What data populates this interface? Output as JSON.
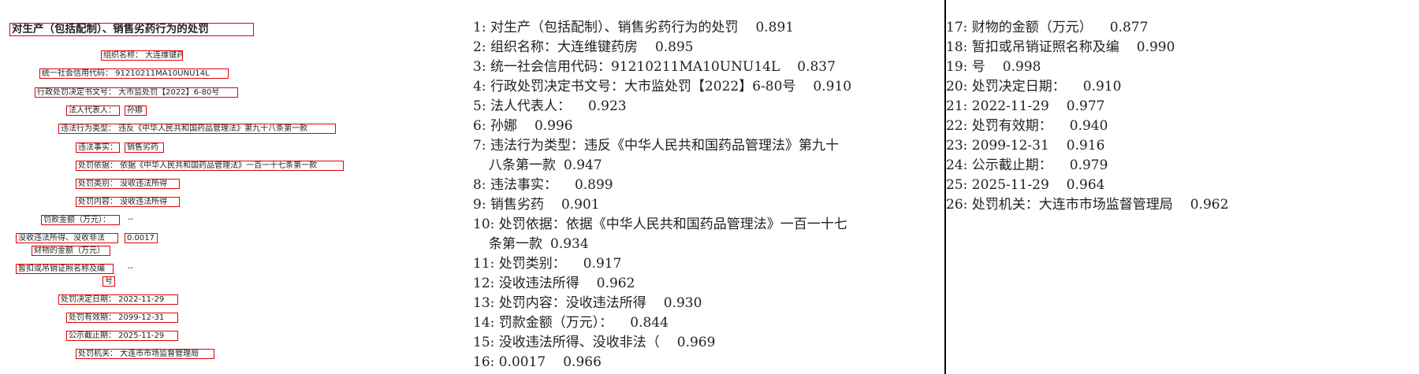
{
  "left_boxes": {
    "title": "对生产（包括配制）、销售劣药行为的处罚",
    "org_name": "组织名称：  大连维键药房",
    "credit_code": "统一社会信用代码：  91210211MA10UNU14L",
    "decision_no": "行政处罚决定书文号：  大市监处罚【2022】6-80号",
    "legal_rep_label": "法人代表人：",
    "legal_rep_value": "孙娜",
    "violation_type": "违法行为类型：  违反《中华人民共和国药品管理法》第九十八条第一款",
    "facts_label": "违法事实：",
    "facts_value": "销售劣药",
    "basis": "处罚依据：  依据《中华人民共和国药品管理法》一百一十七条第一款",
    "category": "处罚类别：  没收违法所得",
    "content": "处罚内容：  没收违法所得",
    "fine": "罚款金额（万元）：",
    "fine_dash": "--",
    "confiscate_label": "没收违法所得、没收非法",
    "confiscate_value": "0.0017",
    "property_label": "财物的金额（万元）",
    "license_label": "暂扣或吊销证照名称及编",
    "license_dash": "--",
    "license_hao": "号",
    "decision_date": "处罚决定日期：  2022-11-29",
    "valid_until": "处罚有效期：  2099-12-31",
    "publicity_end": "公示截止期：  2025-11-29",
    "authority": "处罚机关：  大连市市场监督管理局"
  },
  "ocr_results": [
    {
      "n": "1:",
      "text": "对生产（包括配制）、销售劣药行为的处罚",
      "score": "0.891"
    },
    {
      "n": "2:",
      "text": "组织名称：大连维键药房",
      "score": "0.895"
    },
    {
      "n": "3:",
      "text": "统一社会信用代码：91210211MA10UNU14L",
      "score": "0.837"
    },
    {
      "n": "4:",
      "text": "行政处罚决定书文号：大市监处罚【2022】6-80号",
      "score": "0.910"
    },
    {
      "n": "5:",
      "text": "法人代表人：",
      "score": "0.923"
    },
    {
      "n": "6:",
      "text": "孙娜",
      "score": "0.996"
    },
    {
      "n": "7:",
      "text": "违法行为类型：违反《中华人民共和国药品管理法》第九十",
      "text2": "八条第一款",
      "score": "0.947"
    },
    {
      "n": "8:",
      "text": "违法事实：",
      "score": "0.899"
    },
    {
      "n": "9:",
      "text": "销售劣药",
      "score": "0.901"
    },
    {
      "n": "10:",
      "text": "处罚依据：依据《中华人民共和国药品管理法》一百一十七",
      "text2": "条第一款",
      "score": "0.934"
    },
    {
      "n": "11:",
      "text": "处罚类别：",
      "score": "0.917"
    },
    {
      "n": "12:",
      "text": "没收违法所得",
      "score": "0.962"
    },
    {
      "n": "13:",
      "text": "处罚内容：没收违法所得",
      "score": "0.930"
    },
    {
      "n": "14:",
      "text": "罚款金额（万元）：",
      "score": "0.844"
    },
    {
      "n": "15:",
      "text": "没收违法所得、没收非法（",
      "score": "0.969"
    },
    {
      "n": "16:",
      "text": "0.0017",
      "score": "0.966"
    },
    {
      "n": "17:",
      "text": "财物的金额（万元）",
      "score": "0.877"
    },
    {
      "n": "18:",
      "text": "暂扣或吊销证照名称及编",
      "score": "0.990"
    },
    {
      "n": "19:",
      "text": "号",
      "score": "0.998"
    },
    {
      "n": "20:",
      "text": "处罚决定日期：",
      "score": "0.910"
    },
    {
      "n": "21:",
      "text": "2022-11-29",
      "score": "0.977"
    },
    {
      "n": "22:",
      "text": "处罚有效期：",
      "score": "0.940"
    },
    {
      "n": "23:",
      "text": "2099-12-31",
      "score": "0.916"
    },
    {
      "n": "24:",
      "text": "公示截止期：",
      "score": "0.979"
    },
    {
      "n": "25:",
      "text": "2025-11-29",
      "score": "0.964"
    },
    {
      "n": "26:",
      "text": "处罚机关：大连市市场监督管理局",
      "score": "0.962"
    }
  ],
  "colors": {
    "box": "#e00000",
    "divider": "#000000"
  }
}
